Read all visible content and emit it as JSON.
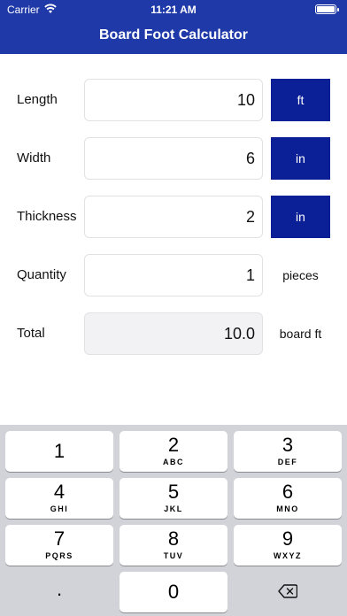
{
  "status": {
    "carrier": "Carrier",
    "time": "11:21 AM"
  },
  "header": {
    "title": "Board Foot Calculator"
  },
  "fields": {
    "length": {
      "label": "Length",
      "value": "10",
      "unit": "ft"
    },
    "width": {
      "label": "Width",
      "value": "6",
      "unit": "in"
    },
    "thickness": {
      "label": "Thickness",
      "value": "2",
      "unit": "in"
    },
    "quantity": {
      "label": "Quantity",
      "value": "1",
      "unit": "pieces"
    },
    "total": {
      "label": "Total",
      "value": "10.0",
      "unit": "board ft"
    }
  },
  "keyboard": {
    "keys": [
      {
        "digit": "1",
        "letters": ""
      },
      {
        "digit": "2",
        "letters": "ABC"
      },
      {
        "digit": "3",
        "letters": "DEF"
      },
      {
        "digit": "4",
        "letters": "GHI"
      },
      {
        "digit": "5",
        "letters": "JKL"
      },
      {
        "digit": "6",
        "letters": "MNO"
      },
      {
        "digit": "7",
        "letters": "PQRS"
      },
      {
        "digit": "8",
        "letters": "TUV"
      },
      {
        "digit": "9",
        "letters": "WXYZ"
      }
    ],
    "dot": ".",
    "zero": "0",
    "delete_icon": "delete-backspace-icon"
  },
  "colors": {
    "header": "#1f3aa8",
    "unit_button": "#0b1f96",
    "keyboard_bg": "#d1d3d9"
  }
}
